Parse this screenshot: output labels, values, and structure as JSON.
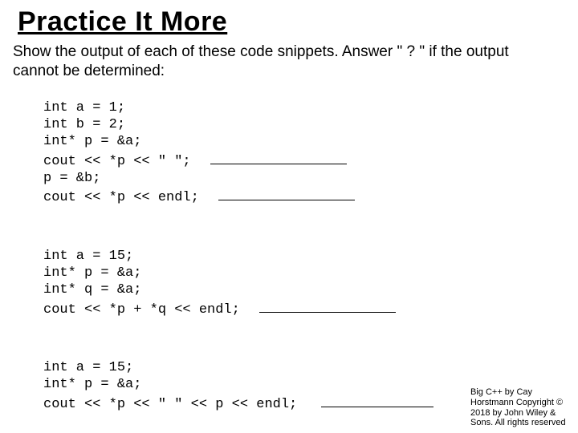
{
  "title": "Practice It More",
  "prompt": "Show the output of each of these code snippets. Answer \" ? \" if the output cannot be determined:",
  "snippet1": {
    "l1": "int a = 1;",
    "l2": "int b = 2;",
    "l3": "int* p = &a;",
    "l4": "cout << *p << \" \";",
    "l5": "p = &b;",
    "l6": "cout << *p << endl;"
  },
  "snippet2": {
    "l1": "int a = 15;",
    "l2": "int* p = &a;",
    "l3": "int* q = &a;",
    "l4": "cout << *p + *q << endl;"
  },
  "snippet3": {
    "l1": "int a = 15;",
    "l2": "int* p = &a;",
    "l3": "cout << *p << \" \" << p << endl;"
  },
  "footer": "Big C++ by Cay Horstmann Copyright © 2018 by John Wiley & Sons. All rights reserved"
}
